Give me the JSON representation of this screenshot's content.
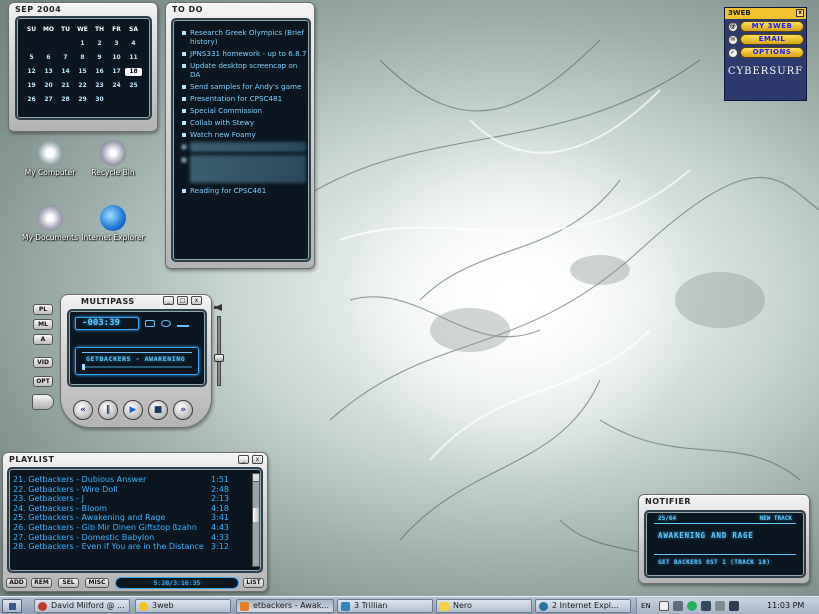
{
  "calendar": {
    "title": "SEP  2004",
    "days": [
      "SU",
      "MO",
      "TU",
      "WE",
      "TH",
      "FR",
      "SA"
    ],
    "dates": [
      "",
      "",
      "",
      "1",
      "2",
      "3",
      "4",
      "5",
      "6",
      "7",
      "8",
      "9",
      "10",
      "11",
      "12",
      "13",
      "14",
      "15",
      "16",
      "17",
      "18",
      "19",
      "20",
      "21",
      "22",
      "23",
      "24",
      "25",
      "26",
      "27",
      "28",
      "29",
      "30",
      "",
      ""
    ],
    "today": "18"
  },
  "todo": {
    "title": "TO DO",
    "items": [
      "Research Greek Olympics (Brief history)",
      "JPNS331 homework - up to 6.8.7",
      "Update desktop screencap on DA",
      "Send samples for Andy's game",
      "Presentation for CPSC481",
      "Special Commission",
      "Collab with Stewy",
      "Watch new Foamy",
      "",
      "",
      "Reading for CPSC461"
    ]
  },
  "desktop_icons": [
    {
      "label": "My Computer"
    },
    {
      "label": "Recycle Bin"
    },
    {
      "label": "My Documents"
    },
    {
      "label": "Internet Explorer"
    }
  ],
  "web3": {
    "title": "3WEB",
    "close": "x",
    "buttons": [
      "MY 3WEB",
      "EMAIL",
      "OPTIONS"
    ],
    "brand": "CYBERSURF"
  },
  "multipass": {
    "title": "MULTIPASS",
    "time": "-003:39",
    "track": "GETBACKERS - AWAKENING",
    "side_buttons": [
      "PL",
      "ML",
      "A",
      "VID",
      "OPT"
    ],
    "window_buttons": [
      "_",
      "□",
      "x"
    ]
  },
  "playlist": {
    "title": "PLAYLIST",
    "rows": [
      {
        "title": "21. Getbackers - Dubious Answer",
        "time": "1:51"
      },
      {
        "title": "22. Getbackers - Wire Doll",
        "time": "2:48"
      },
      {
        "title": "23. Getbackers - J",
        "time": "2:13"
      },
      {
        "title": "24. Getbackers - Bloom",
        "time": "4:18"
      },
      {
        "title": "25. Getbackers - Awakening and Rage",
        "time": "3:41"
      },
      {
        "title": "26. Getbackers - Gib Mir Dinen Giftstop ßzahn",
        "time": "4:43"
      },
      {
        "title": "27. Getbackers - Domestic Babylon",
        "time": "4:33"
      },
      {
        "title": "28. Getbackers - Even if You are in the Distance",
        "time": "3:12"
      }
    ],
    "buttons": [
      "ADD",
      "REM",
      "SEL",
      "MISC",
      "LIST"
    ],
    "info": "5:28/3:16:35"
  },
  "notifier": {
    "title": "NOTIFIER",
    "counter": "25/64",
    "label": "NEW TRACK",
    "song": "AWAKENING AND RAGE",
    "album": "GET BACKERS OST 1 (TRACK 10)"
  },
  "taskbar": {
    "tasks": [
      "David Milford @ ...",
      "3web",
      "etbackers - Awak...",
      "3 Trillian",
      "Nero",
      "2 Internet Expl..."
    ],
    "language": "EN",
    "clock": "11:03 PM"
  }
}
